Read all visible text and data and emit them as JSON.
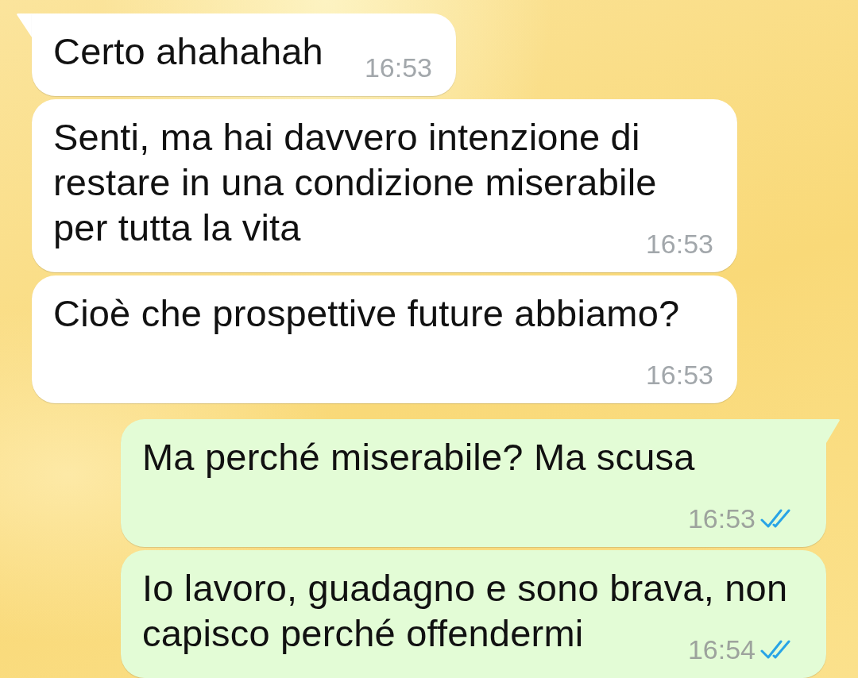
{
  "messages": [
    {
      "kind": "incoming",
      "text": "Certo ahahahah",
      "time": "16:53"
    },
    {
      "kind": "incoming",
      "text": "Senti, ma hai davvero intenzione di\nrestare in una condizione miserabile\nper tutta la vita",
      "time": "16:53"
    },
    {
      "kind": "incoming",
      "text": "Cioè che prospettive future abbiamo?",
      "time": "16:53"
    },
    {
      "kind": "outgoing",
      "text": "Ma perché miserabile? Ma scusa",
      "time": "16:53",
      "read": true
    },
    {
      "kind": "outgoing",
      "text": "Io lavoro, guadagno e sono brava, non\ncapisco perché offendermi",
      "time": "16:54",
      "read": true
    }
  ]
}
